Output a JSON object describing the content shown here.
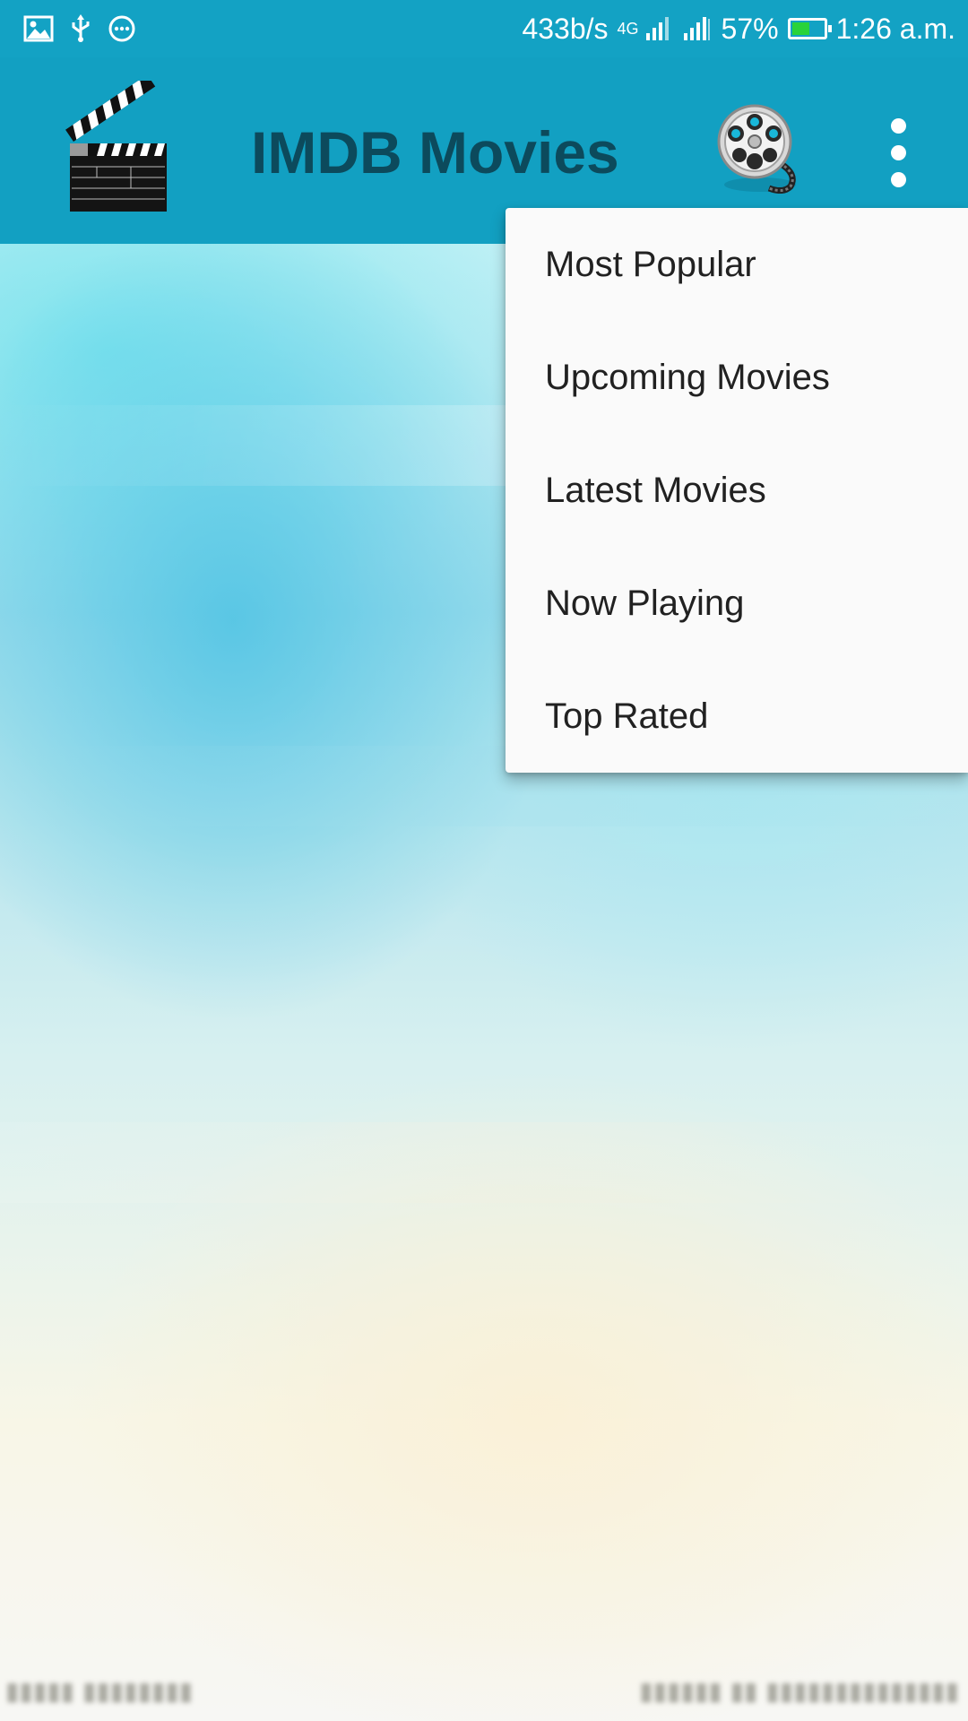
{
  "status_bar": {
    "network_speed": "433b/s",
    "network_type": "4G",
    "battery_percent": "57%",
    "battery_level": 0.57,
    "time": "1:26 a.m.",
    "icons": [
      "image-icon",
      "usb-icon",
      "more-dots-icon",
      "signal-icon",
      "signal-icon",
      "battery-icon"
    ]
  },
  "app_bar": {
    "title": "IMDB Movies",
    "logo_icon": "clapperboard-icon",
    "action_icon": "film-reel-icon",
    "overflow_icon": "more-vert-icon",
    "background_color": "#12a0c2",
    "title_color": "#0c4a5c"
  },
  "menu": {
    "items": [
      {
        "label": "Most Popular"
      },
      {
        "label": "Upcoming Movies"
      },
      {
        "label": "Latest Movies"
      },
      {
        "label": "Now Playing"
      },
      {
        "label": "Top Rated"
      }
    ]
  },
  "colors": {
    "status_bar": "#13a2c4",
    "menu_background": "#fafafa",
    "menu_text": "#212121",
    "battery_fill": "#29d33a"
  }
}
